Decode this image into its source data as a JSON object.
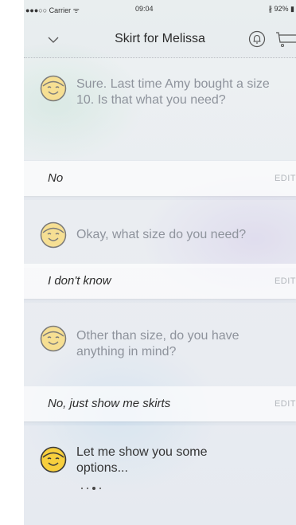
{
  "status_bar": {
    "carrier": "●●●○○ Carrier ᯤ",
    "time": "09:04",
    "battery": "∦ 92% ▮"
  },
  "nav": {
    "title": "Skirt for Melissa",
    "left_icon": "chevron-down-icon",
    "right_icons": [
      "bell-icon",
      "cart-icon"
    ]
  },
  "conversation": [
    {
      "type": "bot",
      "text": "Sure. Last time Amy bought a size 10. Is that what you need?"
    },
    {
      "type": "reply",
      "text": "No",
      "action": "EDIT"
    },
    {
      "type": "bot",
      "text": "Okay, what size do you need?"
    },
    {
      "type": "reply",
      "text": "I don't know",
      "action": "EDIT"
    },
    {
      "type": "bot",
      "text": "Other than size, do you have anything in mind?"
    },
    {
      "type": "reply",
      "text": "No, just show me skirts",
      "action": "EDIT"
    },
    {
      "type": "bot",
      "text": "Let me show you some options..."
    }
  ],
  "typing_indicator": "• • ● •",
  "colors": {
    "avatar_face_muted": "#f6df93",
    "avatar_face_active": "#f7cf3e",
    "avatar_outline": "#3a3a3a",
    "reply_text": "#2d2d2d",
    "bot_text_muted": "#8e939c",
    "bot_text_active": "#333333"
  }
}
